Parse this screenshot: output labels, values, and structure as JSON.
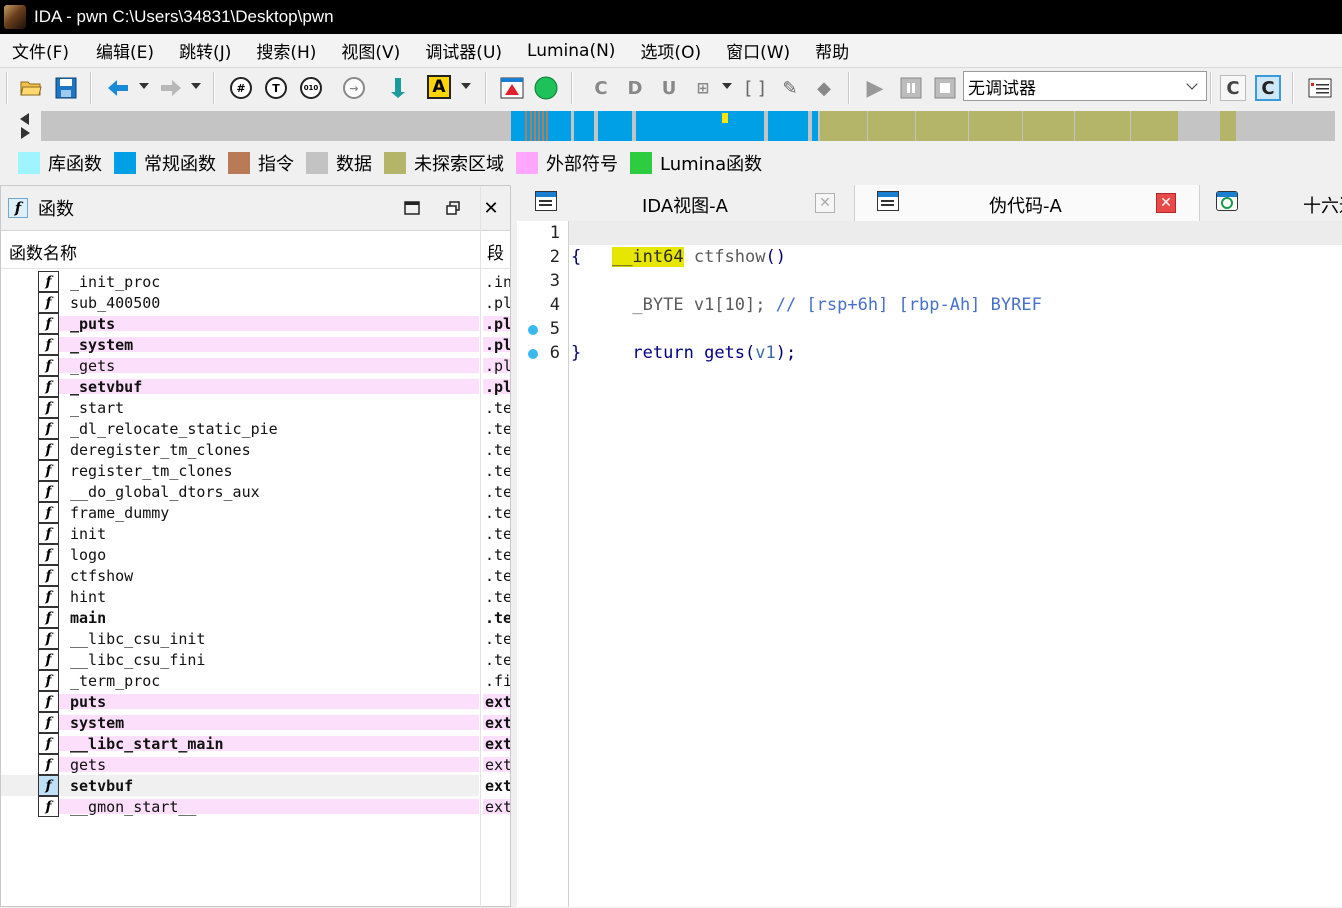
{
  "window": {
    "title": "IDA - pwn C:\\Users\\34831\\Desktop\\pwn"
  },
  "menu": [
    "文件(F)",
    "编辑(E)",
    "跳转(J)",
    "搜索(H)",
    "视图(V)",
    "调试器(U)",
    "Lumina(N)",
    "选项(O)",
    "窗口(W)",
    "帮助"
  ],
  "toolbar": {
    "debugger_select": "无调试器",
    "text_icon": "A"
  },
  "legend": [
    {
      "label": "库函数",
      "color": "#9ff4ff"
    },
    {
      "label": "常规函数",
      "color": "#00a0e6"
    },
    {
      "label": "指令",
      "color": "#b97a57"
    },
    {
      "label": "数据",
      "color": "#c3c3c3"
    },
    {
      "label": "未探索区域",
      "color": "#b5b56a"
    },
    {
      "label": "外部符号",
      "color": "#ffa6ff"
    },
    {
      "label": "Lumina函数",
      "color": "#2ecc40"
    }
  ],
  "functions_panel": {
    "title": "函数",
    "col_name": "函数名称",
    "col_segment": "段",
    "rows": [
      {
        "name": "_init_proc",
        "segment": ".init",
        "style": "normal"
      },
      {
        "name": "sub_400500",
        "segment": ".plt",
        "style": "normal"
      },
      {
        "name": "_puts",
        "segment": ".plt",
        "style": "pink-bold"
      },
      {
        "name": "_system",
        "segment": ".plt",
        "style": "pink-bold"
      },
      {
        "name": "_gets",
        "segment": ".plt",
        "style": "pink"
      },
      {
        "name": "_setvbuf",
        "segment": ".plt",
        "style": "pink-bold"
      },
      {
        "name": "_start",
        "segment": ".text",
        "style": "normal"
      },
      {
        "name": "_dl_relocate_static_pie",
        "segment": ".text",
        "style": "normal"
      },
      {
        "name": "deregister_tm_clones",
        "segment": ".text",
        "style": "normal"
      },
      {
        "name": "register_tm_clones",
        "segment": ".text",
        "style": "normal"
      },
      {
        "name": "__do_global_dtors_aux",
        "segment": ".text",
        "style": "normal"
      },
      {
        "name": "frame_dummy",
        "segment": ".text",
        "style": "normal"
      },
      {
        "name": "init",
        "segment": ".text",
        "style": "normal"
      },
      {
        "name": "logo",
        "segment": ".text",
        "style": "normal"
      },
      {
        "name": "ctfshow",
        "segment": ".text",
        "style": "normal"
      },
      {
        "name": "hint",
        "segment": ".text",
        "style": "normal"
      },
      {
        "name": "main",
        "segment": ".text",
        "style": "bold"
      },
      {
        "name": "__libc_csu_init",
        "segment": ".text",
        "style": "normal"
      },
      {
        "name": "__libc_csu_fini",
        "segment": ".text",
        "style": "normal"
      },
      {
        "name": "_term_proc",
        "segment": ".fini",
        "style": "normal"
      },
      {
        "name": "puts",
        "segment": "extern",
        "style": "pink-bold"
      },
      {
        "name": "system",
        "segment": "extern",
        "style": "pink-bold"
      },
      {
        "name": "__libc_start_main",
        "segment": "extern",
        "style": "pink-bold"
      },
      {
        "name": "gets",
        "segment": "extern",
        "style": "pink"
      },
      {
        "name": "setvbuf",
        "segment": "extern",
        "style": "selected-bold"
      },
      {
        "name": "__gmon_start__",
        "segment": "extern",
        "style": "pink"
      }
    ]
  },
  "tabs": [
    {
      "label": "IDA视图-A",
      "active": false
    },
    {
      "label": "伪代码-A",
      "active": true
    },
    {
      "label": "十六进",
      "active": false
    }
  ],
  "pseudocode": {
    "line_numbers": [
      "1",
      "2",
      "3",
      "4",
      "5",
      "6"
    ],
    "l1_type": "__int64",
    "l1_name": " ctfshow",
    "l1_paren": "()",
    "l2": "{",
    "l3_decl": "  _BYTE v1[10]; ",
    "l3_comment": "// [rsp+6h] [rbp-Ah] BYREF",
    "l5_kw": "  return ",
    "l5_call": "gets",
    "l5_open": "(",
    "l5_arg": "v1",
    "l5_close": ");",
    "l6": "}"
  }
}
